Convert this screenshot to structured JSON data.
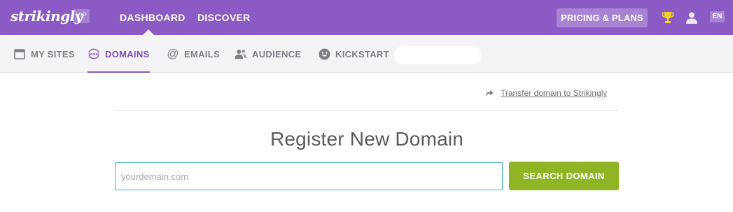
{
  "topbar": {
    "logo": "strikingly",
    "badge": "VIP",
    "nav": {
      "dashboard": "DASHBOARD",
      "discover": "DISCOVER"
    },
    "pricing_label": "PRICING & PLANS",
    "icons": {
      "trophy": "trophy-icon",
      "user": "user-icon"
    },
    "language": "EN",
    "colors": {
      "background": "#8b5ac4",
      "text": "#ffffff"
    }
  },
  "subnav": {
    "items": [
      {
        "label": "MY SITES",
        "icon": "browser-window-icon"
      },
      {
        "label": "DOMAINS",
        "icon": "www-icon",
        "active": true
      },
      {
        "label": "EMAILS",
        "icon": "at-sign-icon"
      },
      {
        "label": "AUDIENCE",
        "icon": "people-icon"
      },
      {
        "label": "KICKSTART",
        "icon": "smiley-icon"
      }
    ],
    "colors": {
      "active": "#7f4dbd",
      "inactive": "#7e7e86"
    }
  },
  "main": {
    "transfer_link": "Transfer domain to Strikingly",
    "heading": "Register New Domain",
    "search": {
      "placeholder": "yourdomain.com",
      "value": ""
    },
    "search_button": "SEARCH DOMAIN",
    "colors": {
      "button": "#8fb424",
      "input_border": "#3ab3b9"
    }
  }
}
